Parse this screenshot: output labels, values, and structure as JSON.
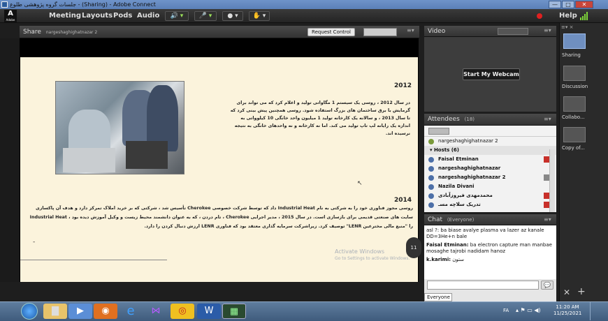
{
  "window": {
    "title": "جلسات گروه پژوهشی طلوع - (Sharing) - Adobe Connect",
    "buttons": {
      "minimize": "—",
      "maximize": "□",
      "close": "✕"
    }
  },
  "menubar": {
    "logo": {
      "letter": "A",
      "caption": "Adobe"
    },
    "items": [
      "Meeting",
      "Layouts",
      "Pods",
      "Audio"
    ],
    "help": "Help"
  },
  "share_pod": {
    "title": "Share",
    "presenter": "nargeshaghighatnazar 2",
    "request_control": "Request Control",
    "slide": {
      "heading_2012": "2012",
      "para_2012": "در سال 2012 ، روسی یک سیستم 1 مگاواتی تولید و اعلام کرد که می تواند برای گرمایش با برق ساختمان های بزرگ استفاده شود. روسی همچنین پیش بینی کرد که تا سال 2013 ، و سالانه یک کارخانه تولید 1 میلیون واحد خانگی 10 کیلوواتی به اندازه یک رایانه لپ تاپ تولید می کند. اما نه کارخانه و نه واحدهای خانگی به نتیجه نرسیده اند.",
      "heading_2014": "2014",
      "para_2014": "روسی مجوز فناوری خود را به شرکتی به نام Industrial Heat داد که توسط شرکت خصوصی Cherokee تأسیس شد ، شرکتی که بر خرید املاک تمرکز دارد و هدف آن پاکسازی سایت های صنعتی قدیمی برای بازسازی است. در سال 2015 ، مدیر اجرایی Cherokee ، تام دردن ، که به عنوان دانشمند محیط زیست و وکیل آموزش دیده بود ، Industrial Heat را \"منبع مالی مخترعین LENR\" توصیف کرد. زیراشرکت سرمایه گذاری معتقد بود که فناوری LENR ارزش دنبال کردن را دارد.",
      "bullet": "-"
    },
    "watermark_line1": "Activate Windows",
    "watermark_line2": "Go to Settings to activate Windows.",
    "page_badge": "11"
  },
  "video_pod": {
    "title": "Video",
    "start_webcam": "Start My Webcam"
  },
  "attendees_pod": {
    "title": "Attendees",
    "count": "(18)",
    "active_speaker": "nargeshaghighatnazar 2",
    "hosts_label": "Hosts (6)",
    "hosts": [
      {
        "name": "Faisal Etminan",
        "mic": "muted"
      },
      {
        "name": "nargeshaghighatnazar",
        "mic": "none"
      },
      {
        "name": "nargeshaghighatnazar 2",
        "mic": "on"
      },
      {
        "name": "Nazila Divani",
        "mic": "none"
      },
      {
        "name": "محمدمهدی فیروزآبادی",
        "mic": "muted"
      },
      {
        "name": "تدریک سلاحِه مسـ",
        "mic": "muted"
      }
    ]
  },
  "chat_pod": {
    "title": "Chat",
    "scope": "(Everyone)",
    "messages": [
      {
        "sender": "",
        "text": "asl ?: ba biase avalye plasma va lazer az kanale DD=3He+n bale"
      },
      {
        "sender": "Faisal Etminan:",
        "text": "ba electron capture man manbae mosaghe tajrobi nadidam hanoz"
      },
      {
        "sender": "k.karimi:",
        "text": "ستون"
      }
    ],
    "target_tab": "Everyone"
  },
  "right_rail": {
    "layouts": [
      "Sharing",
      "Discussion",
      "Collabo...",
      "Copy of..."
    ]
  },
  "taskbar": {
    "lang": "FA",
    "time": "11:20 AM",
    "date": "11/25/2021"
  },
  "colors": {
    "record": "#e02020",
    "accent_green": "#7fd63a",
    "muted_red": "#c8302a"
  }
}
